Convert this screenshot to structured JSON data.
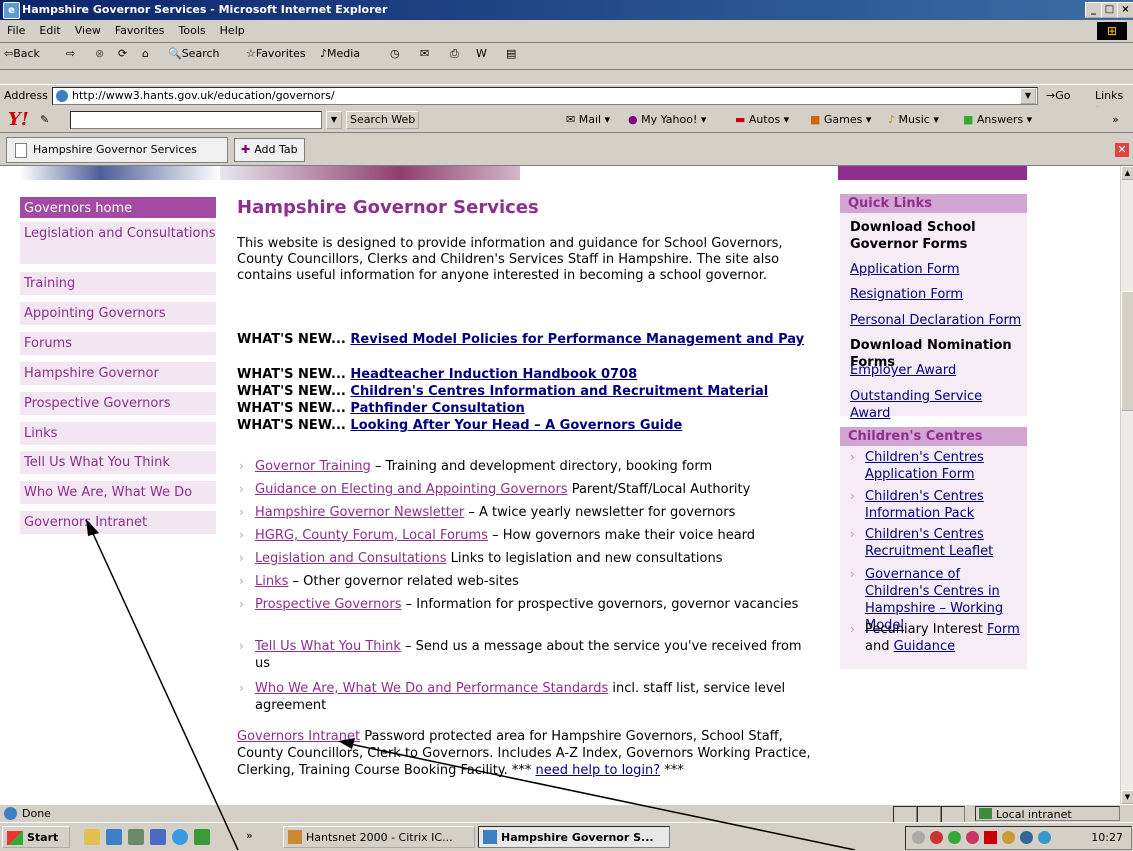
{
  "window": {
    "title": "Hampshire Governor Services - Microsoft Internet Explorer",
    "min": "_",
    "max": "□",
    "close": "×"
  },
  "menu": [
    "File",
    "Edit",
    "View",
    "Favorites",
    "Tools",
    "Help"
  ],
  "toolbar": {
    "back": "⇦Back",
    "forward": "⇨",
    "search": "Search",
    "favorites": "Favorites",
    "media": "Media"
  },
  "address": {
    "label": "Address",
    "url": "http://www3.hants.gov.uk/education/governors/",
    "go": "Go",
    "links": "Links"
  },
  "yahoo": {
    "logo": "Y!",
    "search_web": "Search Web",
    "mail": "Mail",
    "myyahoo": "My Yahoo!",
    "autos": "Autos",
    "games": "Games",
    "music": "Music",
    "answers": "Answers"
  },
  "tabs": {
    "current": "Hampshire Governor Services",
    "add": "Add Tab"
  },
  "nav": [
    "Governors home",
    "Legislation and Consultations",
    "Training",
    "Appointing Governors",
    "Forums",
    "Hampshire Governor",
    "Prospective Governors",
    "Links",
    "Tell Us What You Think",
    "Who We Are, What We Do",
    "Governors Intranet"
  ],
  "main": {
    "title": "Hampshire Governor Services",
    "intro": "This website is designed to provide information and guidance for School Governors, County Councillors, Clerks and Children's Services Staff in Hampshire. The site also contains useful information for anyone interested in becoming a school governor.",
    "whats_new_label": "WHAT'S NEW...",
    "whats_new": [
      "Revised Model Policies for Performance Management and Pay",
      "Headteacher Induction Handbook 0708",
      "Children's Centres Information and Recruitment Material",
      "Pathfinder Consultation",
      "Looking After Your Head – A Governors Guide"
    ],
    "bullets": [
      {
        "link": "Governor Training",
        "text": " – Training and development directory, booking form"
      },
      {
        "link": "Guidance on Electing and Appointing Governors",
        "text": " Parent/Staff/Local Authority"
      },
      {
        "link": "Hampshire Governor Newsletter",
        "text": " – A twice yearly newsletter for governors"
      },
      {
        "link": "HGRG, County Forum, Local Forums",
        "text": " – How governors make their voice heard"
      },
      {
        "link": "Legislation and Consultations",
        "text": " Links to legislation and new consultations"
      },
      {
        "link": "Links",
        "text": " – Other governor related web-sites"
      },
      {
        "link": "Prospective Governors",
        "text": " – Information for prospective governors, governor vacancies"
      },
      {
        "link": "Tell Us What You Think",
        "text": " – Send us a message about the service you've received from us"
      },
      {
        "link": "Who We Are, What We Do and Performance Standards",
        "text": " incl. staff list, service level agreement"
      }
    ],
    "intranet_link": "Governors Intranet",
    "intranet_text": "  Password protected area for Hampshire Governors, School Staff, County Councillors, Clerk to Governors.  Includes A-Z Index, Governors Working Practice, Clerking, Training Course Booking Facility. *** ",
    "help_link": "need help to login?",
    "help_suffix": " ***"
  },
  "quick_links": {
    "heading": "Quick Links",
    "download_school": "Download School Governor Forms",
    "application": "Application Form",
    "resignation": "Resignation Form",
    "personal": "Personal Declaration Form",
    "download_nomination": "Download Nomination Forms",
    "employer": "Employer Award",
    "outstanding": "Outstanding Service Award"
  },
  "childrens_centres": {
    "heading": "Children's Centres",
    "items": [
      "Children's Centres Application Form",
      "Children's Centres Information Pack",
      "Children's Centres Recruitment Leaflet",
      "Governance of Children's Centres in Hampshire – Working Model"
    ],
    "pecuniary_prefix": "Pecuniary Interest ",
    "pecuniary_form": "Form",
    "pecuniary_and": " and ",
    "pecuniary_guidance": "Guidance"
  },
  "status": {
    "text": "Done",
    "zone": "Local intranet"
  },
  "taskbar": {
    "start": "Start",
    "chevron": "»",
    "task1": "Hantsnet 2000 - Citrix IC...",
    "task2": "Hampshire Governor S...",
    "clock": "10:27"
  }
}
